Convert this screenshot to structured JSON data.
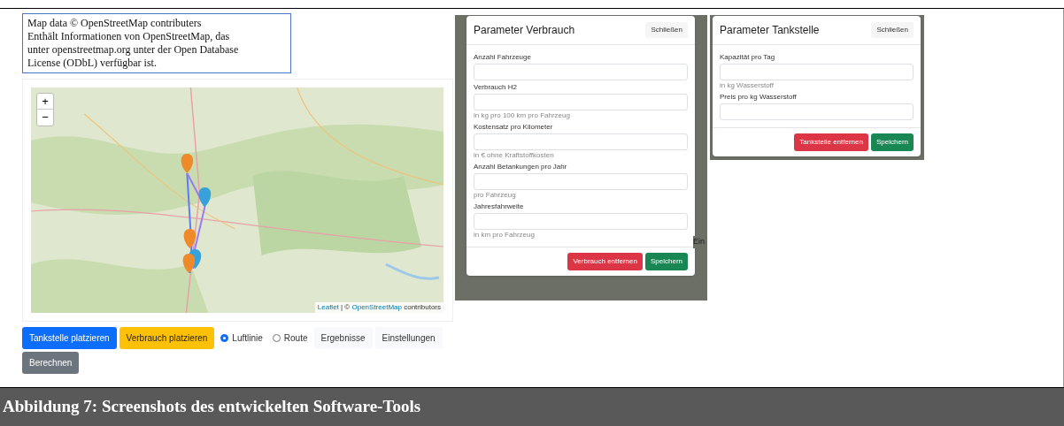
{
  "attribution_note": [
    "Map data © OpenStreetMap contributers",
    "Enthält Informationen von OpenStreetMap, das",
    "unter openstreetmap.org unter der Open Database",
    "License (ODbL) verfügbar ist."
  ],
  "map": {
    "zoom_in": "+",
    "zoom_out": "−",
    "attribution_leaflet": "Leaflet",
    "attribution_sep": "| ©",
    "attribution_osm": "OpenStreetMap",
    "attribution_rest": "contributors"
  },
  "toolbar": [
    {
      "kind": "primary",
      "label": "Tankstelle platzieren"
    },
    {
      "kind": "warning",
      "label": "Verbrauch platzieren"
    },
    {
      "kind": "radio",
      "label": "Luftlinie",
      "selected": true
    },
    {
      "kind": "radio",
      "label": "Route",
      "selected": false
    },
    {
      "kind": "light",
      "label": "Ergebnisse"
    },
    {
      "kind": "light",
      "label": "Einstellungen"
    },
    {
      "kind": "secondary",
      "label": "Berechnen"
    }
  ],
  "modals": [
    {
      "title": "Parameter Verbrauch",
      "close": "Schließen",
      "backdrop_text": "Ein",
      "fields": [
        {
          "label": "Anzahl Fahrzeuge"
        },
        {
          "label": "Verbrauch H2",
          "help": "in kg pro 100 km pro Fahrzeug"
        },
        {
          "label": "Kostensatz pro Kilometer",
          "help": "in € ohne Kraftstoffkosten"
        },
        {
          "label": "Anzahl Betankungen pro Jahr",
          "help": "pro Fahrzeug"
        },
        {
          "label": "Jahresfahrweite",
          "help": "in km pro Fahrzeug"
        }
      ],
      "remove": "Verbrauch entfernen",
      "save": "Speichern"
    },
    {
      "title": "Parameter Tankstelle",
      "close": "Schließen",
      "fields": [
        {
          "label": "Kapazität pro Tag",
          "help": "in kg Wasserstoff"
        },
        {
          "label": "Preis pro kg Wasserstoff"
        }
      ],
      "remove": "Tankstelle entfernen",
      "save": "Speichern"
    }
  ],
  "caption": "Abbildung 7: Screenshots des entwickelten Software-Tools"
}
